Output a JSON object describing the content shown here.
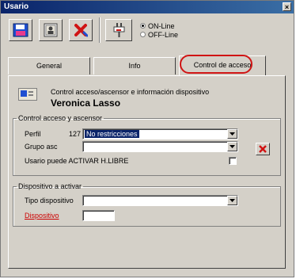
{
  "window": {
    "title": "Usario",
    "close_glyph": "×"
  },
  "toolbar": {
    "buttons": [
      {
        "icon": "save-icon"
      },
      {
        "icon": "user-card-icon"
      },
      {
        "icon": "delete-x-icon"
      },
      {
        "icon": "plug-icon"
      }
    ],
    "connection": {
      "options": [
        {
          "label": "ON-Line",
          "selected": true
        },
        {
          "label": "OFF-Line",
          "selected": false
        }
      ]
    }
  },
  "tabs": [
    {
      "label": "General",
      "active": false
    },
    {
      "label": "Info",
      "active": false
    },
    {
      "label": "Control de acceso",
      "active": true
    }
  ],
  "header": {
    "subtitle": "Control acceso/ascensor e información dispositivo",
    "name": "Veronica Lasso"
  },
  "control_box": {
    "legend": "Control acceso y ascensor",
    "perfil_label": "Perfil",
    "perfil_code": "127",
    "perfil_value": "No restricciones",
    "grupo_label": "Grupo asc",
    "grupo_value": "",
    "hlibre_label": "Usario puede ACTIVAR H.LIBRE",
    "hlibre_checked": false
  },
  "device_box": {
    "legend": "Dispositivo a activar",
    "tipo_label": "Tipo dispositivo",
    "tipo_value": "",
    "dispositivo_label": "Dispositivo",
    "dispositivo_value": ""
  },
  "colors": {
    "title_bar": "#0a246a",
    "accent_red": "#cc0000",
    "selection": "#0a246a"
  }
}
